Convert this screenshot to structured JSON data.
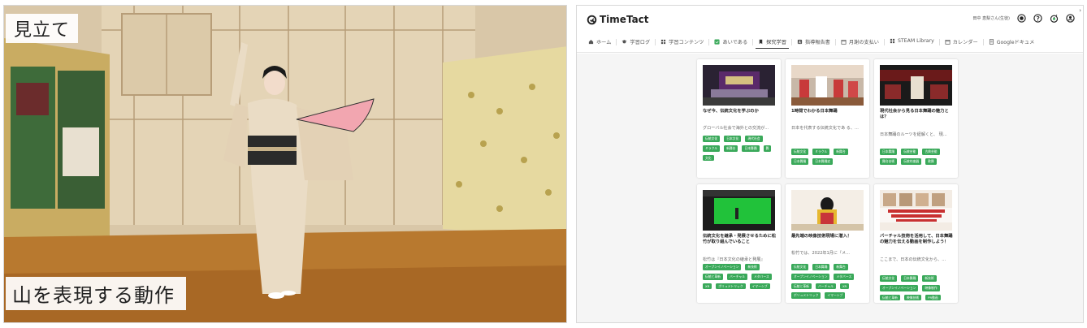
{
  "video": {
    "caption_top": "見立て",
    "caption_bottom": "山を表現する動作"
  },
  "app": {
    "brand": "TimeTact",
    "user_name": "田中 恵梨さん(生徒)",
    "header_icons": [
      "record-icon",
      "help-icon",
      "timer-icon",
      "account-icon"
    ],
    "tabs": [
      {
        "label": "ホーム",
        "icon": "home-icon",
        "active": false
      },
      {
        "label": "学習ログ",
        "icon": "graduation-icon",
        "active": false
      },
      {
        "label": "学習コンテンツ",
        "icon": "grid-icon",
        "active": false
      },
      {
        "label": "あいである",
        "icon": "idea-icon",
        "active": false
      },
      {
        "label": "探究学習",
        "icon": "bookmark-icon",
        "active": true
      },
      {
        "label": "指導報告書",
        "icon": "report-icon",
        "active": false
      },
      {
        "label": "月謝の支払い",
        "icon": "calendar-icon",
        "active": false
      },
      {
        "label": "STEAM Library",
        "icon": "library-icon",
        "active": false
      },
      {
        "label": "カレンダー",
        "icon": "calendar-icon",
        "active": false
      },
      {
        "label": "Googleドキュメ",
        "icon": "doc-icon",
        "active": false
      }
    ],
    "accent_color": "#3aa95a",
    "cards": [
      {
        "title": "なぜ今、伝統文化を学ぶのか",
        "desc": "グローバル社会で海外との交流が...",
        "tags": [
          "伝統文化",
          "日本文化",
          "現代社会",
          "ミラクル",
          "新舞台",
          "日本舞踊",
          "舞",
          "文化"
        ]
      },
      {
        "title": "1時間でわかる日本舞踊",
        "desc": "日本を代表する伝統文化であ る、...",
        "tags": [
          "伝統文化",
          "ミラクル",
          "新舞台",
          "日本舞踊",
          "日本舞踊史"
        ]
      },
      {
        "title": "現代社会から見る日本舞踊の魅力とは？",
        "desc": "日本舞踊のルーツを紐解くと、 現...",
        "tags": [
          "日本舞踊",
          "伝統芸能",
          "古典芸能",
          "舞台芸術",
          "伝統的楽器",
          "歌舞"
        ]
      },
      {
        "title": "伝統文化を継承・発展させるために松竹が取り組んでいること",
        "desc": "松竹は『日本文化の継承と発展』",
        "tags": [
          "オープンイノベーション",
          "新技術",
          "伝統と革新",
          "バーチャル",
          "メタバース",
          "XR",
          "ボリュメトリック",
          "イマーシブ"
        ]
      },
      {
        "title": "最先端の映像技術現場に潜入！",
        "desc": "松竹では、2022年1月に『メ...",
        "tags": [
          "伝統文化",
          "日本舞踊",
          "新舞台",
          "オープンイノベーション",
          "メタバース",
          "伝統と革新",
          "バーチャル",
          "XR",
          "ボリュメトリック",
          "イマーシブ"
        ]
      },
      {
        "title": "バーチャル技術を活用して、日本舞踊の魅力を伝える動画を制作しよう！",
        "desc": "ここまで、日本の伝統文化から、...",
        "tags": [
          "伝統文化",
          "日本舞踊",
          "新技術",
          "オープンイノベーション",
          "映像制作",
          "伝統と革新",
          "映像技術",
          "PR動画"
        ]
      }
    ]
  }
}
